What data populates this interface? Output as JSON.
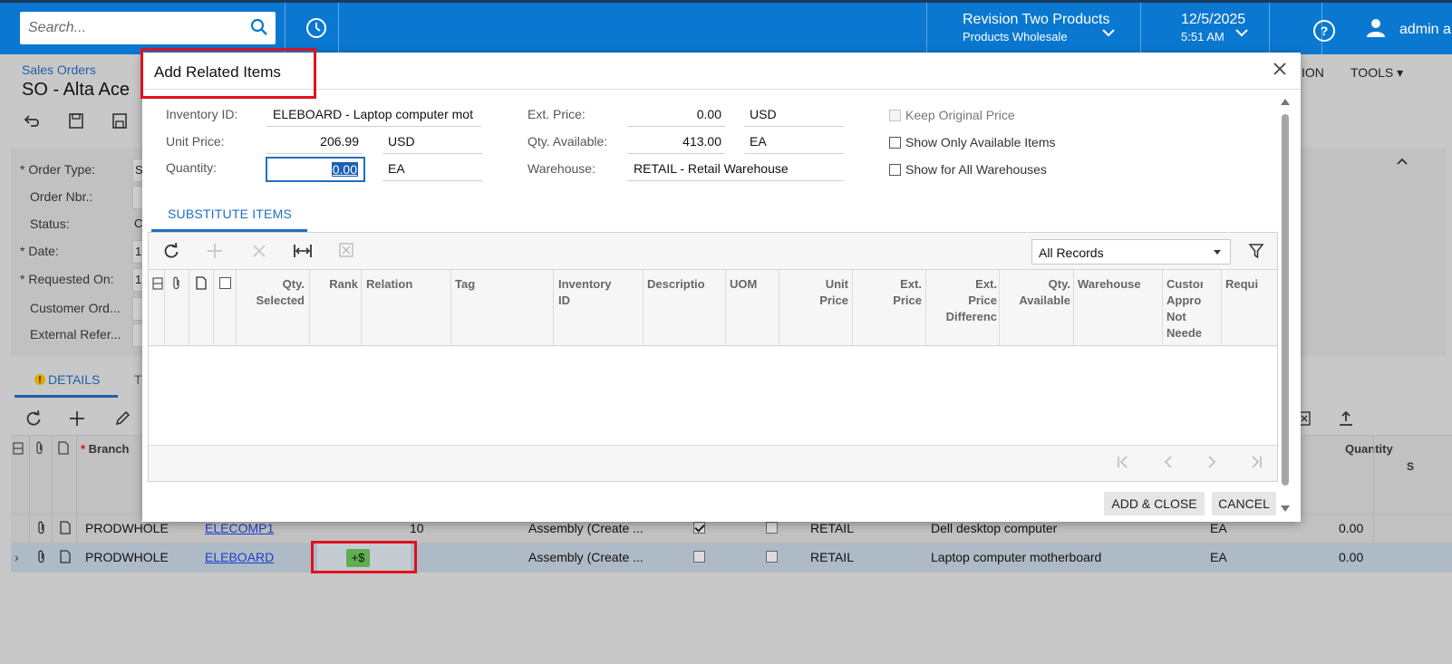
{
  "topbar": {
    "search_placeholder": "Search...",
    "company_name": "Revision Two Products",
    "company_branch": "Products Wholesale",
    "date": "12/5/2025",
    "time": "5:51 AM",
    "user": "admin a"
  },
  "page": {
    "breadcrumb": "Sales Orders",
    "title": "SO - Alta Ace",
    "tools_left": "ION",
    "tools": "TOOLS",
    "form_labels": {
      "order_type": "Order Type:",
      "order_nbr": "Order Nbr.:",
      "status": "Status:",
      "date": "Date:",
      "requested_on": "Requested On:",
      "customer_order": "Customer Ord...",
      "external_ref": "External Refer..."
    },
    "form_stubs": [
      "S",
      "",
      "C",
      "1",
      "1",
      "",
      ""
    ],
    "tabs": {
      "details": "DETAILS",
      "next": "T"
    },
    "grid_headers": {
      "branch": "Branch",
      "quantity": "Quantity",
      "s": "S"
    },
    "rows": [
      {
        "branch": "PRODWHOLE",
        "item": "ELECOMP1",
        "col_num": "10",
        "type": "Assembly (Create ...",
        "checked": true,
        "warehouse": "RETAIL",
        "description": "Dell desktop computer",
        "uom": "EA",
        "quantity": "0.00"
      },
      {
        "branch": "PRODWHOLE",
        "item": "ELEBOARD",
        "badge": "+$",
        "type": "Assembly (Create ...",
        "checked": false,
        "warehouse": "RETAIL",
        "description": "Laptop computer motherboard",
        "uom": "EA",
        "quantity": "0.00"
      }
    ]
  },
  "dialog": {
    "title": "Add Related Items",
    "labels": {
      "inventory_id": "Inventory ID:",
      "unit_price": "Unit Price:",
      "quantity": "Quantity:",
      "ext_price": "Ext. Price:",
      "qty_available": "Qty. Available:",
      "warehouse": "Warehouse:"
    },
    "values": {
      "inventory_id": "ELEBOARD - Laptop computer mot",
      "unit_price": "206.99",
      "unit_price_cur": "USD",
      "quantity": "0.00",
      "quantity_uom": "EA",
      "ext_price": "0.00",
      "ext_price_cur": "USD",
      "qty_available": "413.00",
      "qty_available_uom": "EA",
      "warehouse": "RETAIL - Retail Warehouse"
    },
    "checkboxes": {
      "keep_original_price": "Keep Original Price",
      "show_only_available": "Show Only Available Items",
      "show_all_warehouses": "Show for All Warehouses"
    },
    "tab": "SUBSTITUTE ITEMS",
    "filter": "All Records",
    "columns": {
      "qty_selected": [
        "Qty.",
        "Selected"
      ],
      "rank": "Rank",
      "relation": "Relation",
      "tag": "Tag",
      "inventory_id": [
        "Inventory",
        "ID"
      ],
      "description": "Descriptio",
      "uom": "UOM",
      "unit_price": [
        "Unit",
        "Price"
      ],
      "ext_price": [
        "Ext.",
        "Price"
      ],
      "ext_price_diff": [
        "Ext.",
        "Price",
        "Differenc"
      ],
      "qty_available": [
        "Qty.",
        "Available"
      ],
      "warehouse": "Warehouse",
      "customer_approval": [
        "Custor",
        "Appro",
        "Not",
        "Neede"
      ],
      "required": "Requi"
    },
    "buttons": {
      "add_close": "ADD & CLOSE",
      "cancel": "CANCEL"
    }
  },
  "colors": {
    "topbar": "#0a78d0",
    "accent": "#1f6fc0",
    "highlight_box": "#e01020",
    "badge": "#5fae52"
  }
}
